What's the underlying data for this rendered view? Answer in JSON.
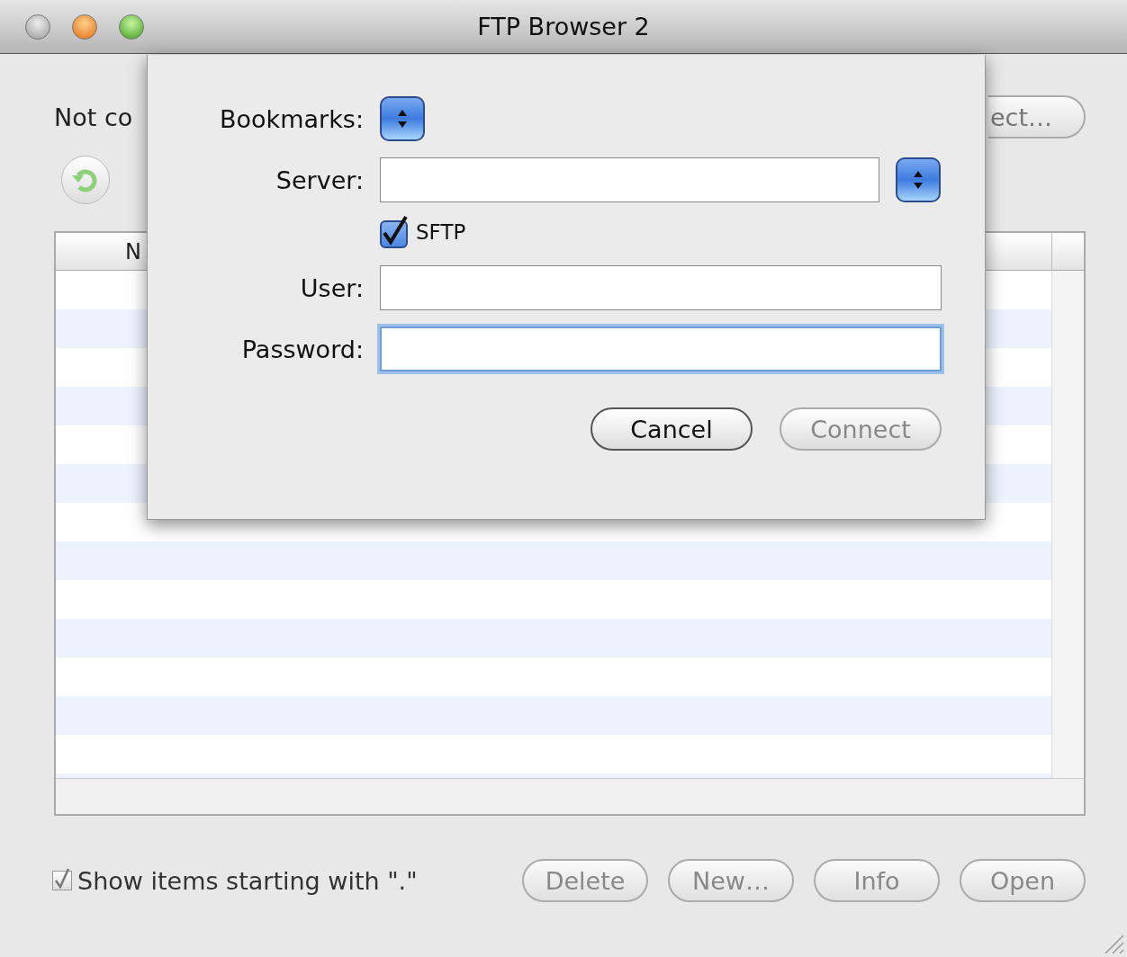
{
  "window": {
    "title": "FTP Browser 2"
  },
  "status": {
    "text": "Not co"
  },
  "connect_button": {
    "label": "ect…"
  },
  "table": {
    "columns": [
      {
        "label": "N"
      }
    ]
  },
  "show_hidden": {
    "label": "Show items starting with \".\"",
    "checked": true
  },
  "buttons": [
    {
      "label": "Delete",
      "disabled": true
    },
    {
      "label": "New…",
      "disabled": true
    },
    {
      "label": "Info",
      "disabled": true
    },
    {
      "label": "Open",
      "disabled": true
    }
  ],
  "sheet": {
    "fields": [
      {
        "kind": "popup",
        "label": "Bookmarks:"
      },
      {
        "kind": "combo",
        "label": "Server:"
      },
      {
        "kind": "checkbox",
        "label": "SFTP",
        "checked": true
      },
      {
        "kind": "text",
        "label": "User:",
        "focused": false
      },
      {
        "kind": "text",
        "label": "Password:",
        "focused": true
      }
    ],
    "buttons": [
      {
        "label": "Cancel",
        "disabled": false
      },
      {
        "label": "Connect",
        "disabled": true
      }
    ]
  }
}
